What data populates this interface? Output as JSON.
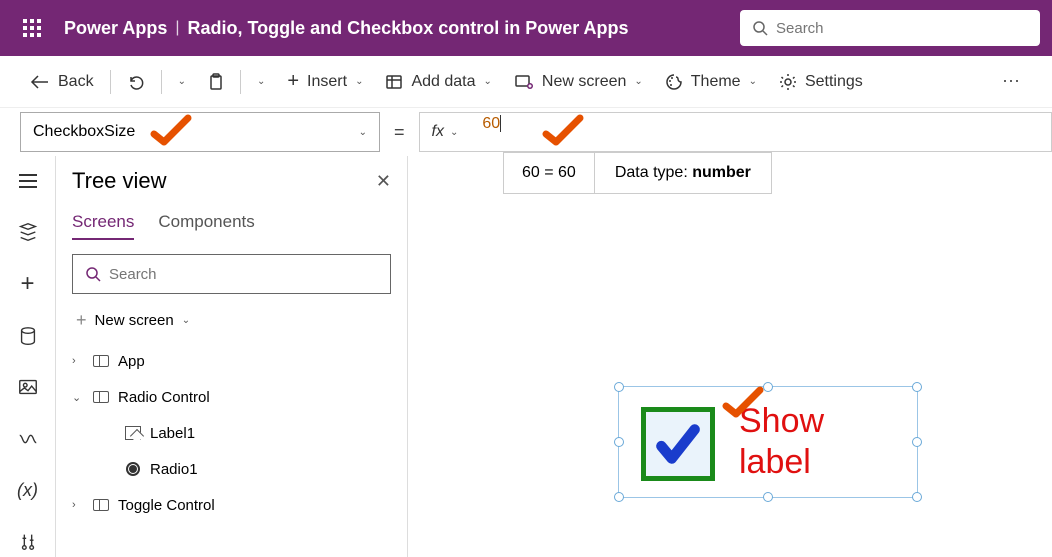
{
  "header": {
    "app_name": "Power Apps",
    "page_title": "Radio, Toggle and Checkbox control in Power Apps",
    "search_placeholder": "Search"
  },
  "toolbar": {
    "back": "Back",
    "insert": "Insert",
    "add_data": "Add data",
    "new_screen": "New screen",
    "theme": "Theme",
    "settings": "Settings"
  },
  "formula": {
    "property": "CheckboxSize",
    "fx_label": "fx",
    "value": "60",
    "hint_eq": "60  =  60",
    "hint_type_label": "Data type: ",
    "hint_type_value": "number"
  },
  "tree": {
    "title": "Tree view",
    "tabs": {
      "screens": "Screens",
      "components": "Components"
    },
    "search_placeholder": "Search",
    "new_screen": "New screen",
    "items": {
      "app": "App",
      "radio_control": "Radio Control",
      "label1": "Label1",
      "radio1": "Radio1",
      "toggle_control": "Toggle Control"
    }
  },
  "canvas": {
    "checkbox_label": "Show label"
  },
  "colors": {
    "brand": "#742774",
    "annot": "#e65100",
    "check": "#1a3ccc",
    "cb_border": "#1a8a1a",
    "cb_label": "#e01010"
  }
}
